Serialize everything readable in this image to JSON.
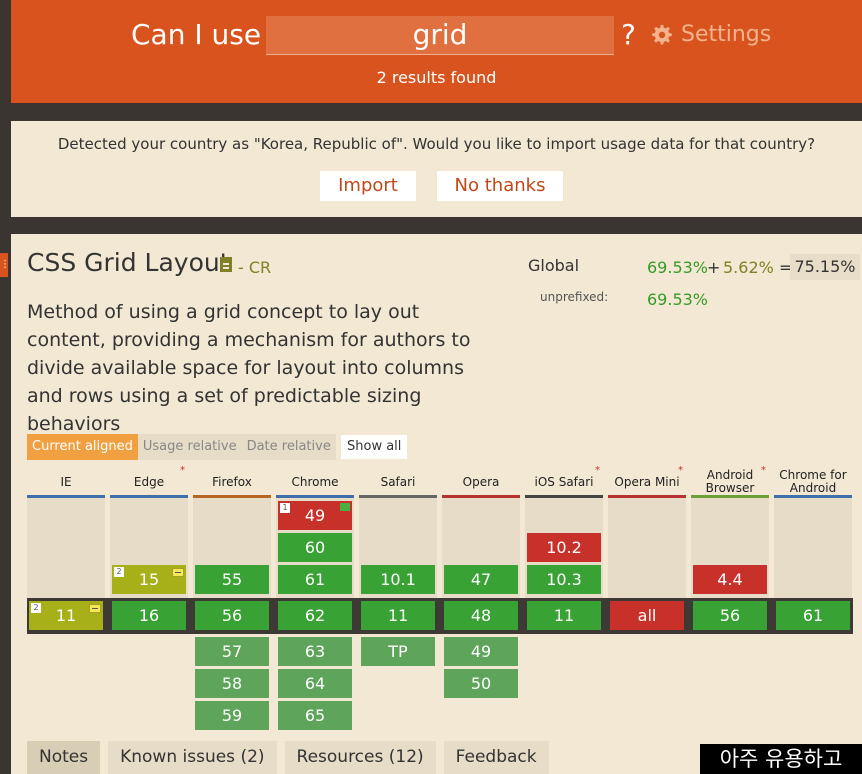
{
  "header": {
    "brand": "Can I use",
    "search_value": "grid",
    "question_mark": "?",
    "settings_label": "Settings",
    "results": "2 results found"
  },
  "notice": {
    "text": "Detected your country as \"Korea, Republic of\". Would you like to import usage data for that country?",
    "import_label": "Import",
    "no_thanks_label": "No thanks"
  },
  "feature": {
    "title": "CSS Grid Layout",
    "status": "- CR",
    "description": "Method of using a grid concept to lay out content, providing a mechanism for authors to divide available space for layout into columns and rows using a set of predictable sizing behaviors",
    "global_label": "Global",
    "global_supported": "69.53%",
    "plus": "+",
    "global_partial": "5.62%",
    "equals": "=",
    "global_total": "75.15%",
    "unprefixed_label": "unprefixed:",
    "unprefixed_value": "69.53%"
  },
  "view_tabs": [
    "Current aligned",
    "Usage relative",
    "Date relative"
  ],
  "show_all": "Show all",
  "browsers": [
    {
      "name": "IE",
      "asterisk": false,
      "bar_color": "#3f6fa8"
    },
    {
      "name": "Edge",
      "asterisk": true,
      "bar_color": "#3f6fa8"
    },
    {
      "name": "Firefox",
      "asterisk": false,
      "bar_color": "#b86624"
    },
    {
      "name": "Chrome",
      "asterisk": false,
      "bar_color": "#3f6fa8"
    },
    {
      "name": "Safari",
      "asterisk": false,
      "bar_color": "#666666"
    },
    {
      "name": "Opera",
      "asterisk": false,
      "bar_color": "#b83030"
    },
    {
      "name": "iOS Safari",
      "asterisk": true,
      "bar_color": "#444444"
    },
    {
      "name": "Opera Mini",
      "asterisk": true,
      "bar_color": "#b83030"
    },
    {
      "name": "Android Browser",
      "asterisk": true,
      "bar_color": "#6ea03a"
    },
    {
      "name": "Chrome for Android",
      "asterisk": false,
      "bar_color": "#3f6fa8"
    }
  ],
  "versions": {
    "chrome_old": [
      "49",
      "60",
      "61"
    ],
    "edge_prev": "15",
    "firefox_prev": "55",
    "safari_prev": "10.1",
    "opera_prev": "47",
    "ios_old": [
      "10.2",
      "10.3"
    ],
    "android_prev": "4.4",
    "current": [
      "11",
      "16",
      "56",
      "62",
      "11",
      "48",
      "11",
      "all",
      "56",
      "61"
    ],
    "firefox_future": [
      "57",
      "58",
      "59"
    ],
    "chrome_future": [
      "63",
      "64",
      "65"
    ],
    "safari_future": "TP",
    "opera_future": [
      "49",
      "50"
    ],
    "note_ie": "2",
    "note_edge": "2",
    "note_chrome": "1"
  },
  "bottom_tabs": [
    "Notes",
    "Known issues (2)",
    "Resources (12)",
    "Feedback"
  ],
  "overlay_text": "아주 유용하고",
  "colors": {
    "supported": "#39a234",
    "unsupported": "#c8302a",
    "partial": "#a7b018",
    "brand": "#d9531e"
  }
}
